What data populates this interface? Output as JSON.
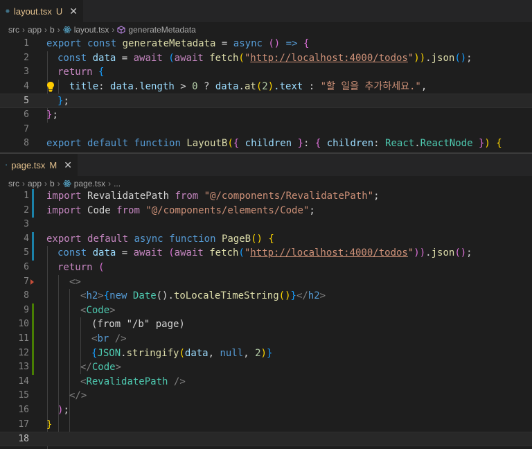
{
  "top": {
    "tab": {
      "filename": "layout.tsx",
      "status": "U",
      "close": "✕"
    },
    "breadcrumb": [
      "src",
      "app",
      "b",
      "layout.tsx",
      "generateMetadata"
    ],
    "line_numbers": [
      "1",
      "2",
      "3",
      "4",
      "5",
      "6",
      "7",
      "8"
    ],
    "active_line": "5",
    "code": {
      "l1": {
        "a": "export",
        "b": "const",
        "c": "generateMetadata",
        "d": "=",
        "e": "async",
        "f": "()",
        "g": "=>",
        "h": "{"
      },
      "l2": {
        "a": "const",
        "b": "data",
        "c": "=",
        "d": "await",
        "e": "(",
        "f": "await",
        "g": "fetch",
        "h": "(",
        "i": "\"",
        "j": "http://localhost:4000/todos",
        "k": "\"",
        "l": "))",
        "m": ".",
        "n": "json",
        "o": "()",
        "p": ";"
      },
      "l3": {
        "a": "return",
        "b": "{"
      },
      "l4": {
        "a": "title",
        "b": ":",
        "c": "data",
        "d": ".",
        "e": "length",
        "f": ">",
        "g": "0",
        "h": "?",
        "i": "data",
        "j": ".",
        "k": "at",
        "l": "(",
        "m": "2",
        "n": ")",
        "o": ".text",
        "p": ":",
        "q": "\"할 일을 추가하세요.\"",
        "r": ","
      },
      "l5": {
        "a": "}",
        "b": ";"
      },
      "l6": {
        "a": "}",
        "b": ";"
      },
      "l8": {
        "a": "export",
        "b": "default",
        "c": "function",
        "d": "LayoutB",
        "e": "(",
        "f": "{",
        "g": "children",
        "h": "}",
        "i": ":",
        "j": "{",
        "k": "children",
        "l": ":",
        "m": "React",
        "n": ".",
        "o": "ReactNode",
        "p": "}",
        "q": ")",
        "r": "{"
      }
    }
  },
  "bottom": {
    "tab": {
      "filename": "page.tsx",
      "status": "M",
      "close": "✕"
    },
    "breadcrumb": [
      "src",
      "app",
      "b",
      "page.tsx",
      "..."
    ],
    "line_numbers": [
      "1",
      "2",
      "3",
      "4",
      "5",
      "6",
      "7",
      "8",
      "9",
      "10",
      "11",
      "12",
      "13",
      "14",
      "15",
      "16",
      "17",
      "18"
    ],
    "active_line": "18",
    "code": {
      "l1": {
        "a": "import",
        "b": "RevalidatePath",
        "c": "from",
        "d": "\"@/components/RevalidatePath\"",
        "e": ";"
      },
      "l2": {
        "a": "import",
        "b": "Code",
        "c": "from",
        "d": "\"@/components/elements/Code\"",
        "e": ";"
      },
      "l4": {
        "a": "export",
        "b": "default",
        "c": "async",
        "d": "function",
        "e": "PageB",
        "f": "()",
        "g": "{"
      },
      "l5": {
        "a": "const",
        "b": "data",
        "c": "=",
        "d": "await",
        "e": "(",
        "f": "await",
        "g": "fetch",
        "h": "(",
        "i": "\"",
        "j": "http://localhost:4000/todos",
        "k": "\"",
        "l": "))",
        "m": ".",
        "n": "json",
        "o": "()",
        "p": ";"
      },
      "l6": {
        "a": "return",
        "b": "("
      },
      "l7": {
        "a": "<>"
      },
      "l8": {
        "a": "<",
        "b": "h2",
        "c": ">",
        "d": "{",
        "e": "new",
        "f": "Date",
        "g": "().",
        "h": "toLocaleTimeString",
        "i": "()",
        "j": "}",
        "k": "</",
        "l": "h2",
        "m": ">"
      },
      "l9": {
        "a": "<",
        "b": "Code",
        "c": ">"
      },
      "l10": {
        "a": "(from \"/b\" page)"
      },
      "l11": {
        "a": "<",
        "b": "br",
        "c": "/>"
      },
      "l12": {
        "a": "{",
        "b": "JSON",
        "c": ".",
        "d": "stringify",
        "e": "(",
        "f": "data",
        "g": ",",
        "h": "null",
        "i": ",",
        "j": "2",
        "k": ")",
        "l": "}"
      },
      "l13": {
        "a": "</",
        "b": "Code",
        "c": ">"
      },
      "l14": {
        "a": "<",
        "b": "RevalidatePath",
        "c": "/>"
      },
      "l15": {
        "a": "</>"
      },
      "l16": {
        "a": ")",
        "b": ";"
      },
      "l17": {
        "a": "}"
      }
    }
  },
  "colors": {
    "background": "#1e1e1e",
    "keyword": "#569cd6",
    "control_keyword": "#c586c0",
    "function": "#dcdcaa",
    "variable": "#9cdcfe",
    "string": "#ce9178",
    "type": "#4ec9b0",
    "number": "#b5cea8",
    "tab_untracked": "#e2c08d",
    "gutter_modified": "#1b81a8",
    "gutter_added": "#487e02",
    "gutter_deleted": "#c74e39"
  }
}
